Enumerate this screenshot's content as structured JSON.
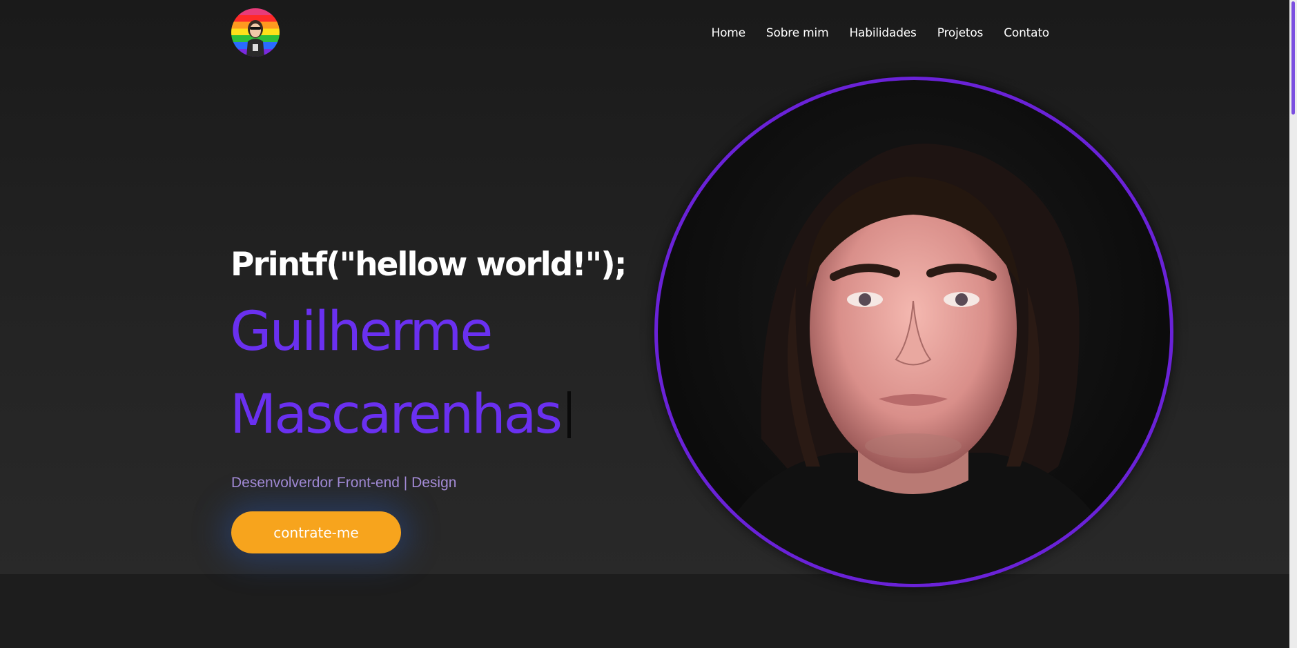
{
  "header": {
    "logo_icon": "rainbow-avatar-logo",
    "nav": [
      "Home",
      "Sobre mim",
      "Habilidades",
      "Projetos",
      "Contato"
    ]
  },
  "hero": {
    "intro": "Printf(\"hellow world!\");",
    "name_line1": "Guilherme",
    "name_line2": "Mascarenhas",
    "subtitle": "Desenvolverdor Front-end | Design",
    "cta_label": "contrate-me",
    "portrait_icon": "profile-photo"
  },
  "colors": {
    "accent": "#6a30f0",
    "button": "#f7a41d",
    "portrait_border": "#6a22d8",
    "background": "#1b1b1b"
  }
}
